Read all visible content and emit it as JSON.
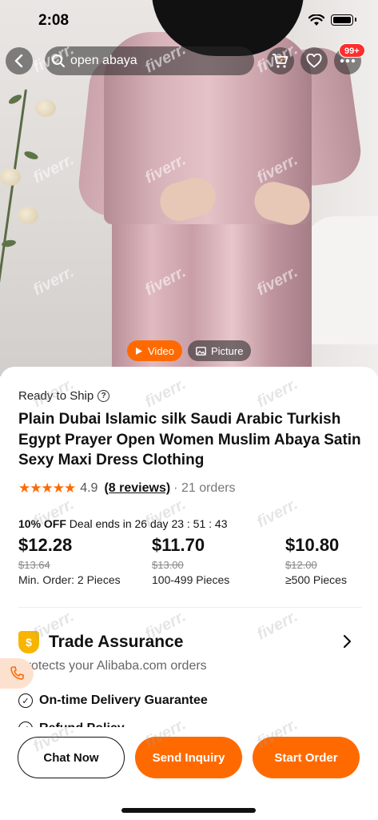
{
  "status_bar": {
    "time": "2:08"
  },
  "search": {
    "query": "open abaya"
  },
  "cart_badge": "99+",
  "media_tabs": [
    {
      "label": "Video"
    },
    {
      "label": "Picture"
    }
  ],
  "product": {
    "shipping_status": "Ready to Ship",
    "title": "Plain Dubai Islamic silk Saudi Arabic Turkish Egypt Prayer Open Women Muslim Abaya Satin Sexy Maxi Dress Clothing",
    "rating": "4.9",
    "reviews": "(8 reviews)",
    "orders": "· 21 orders"
  },
  "deal": {
    "discount": "10% OFF",
    "text": "Deal ends in 26 day 23 : 51 : 43"
  },
  "prices": [
    {
      "price": "$12.28",
      "original": "$13.64",
      "quantity": "Min. Order: 2 Pieces"
    },
    {
      "price": "$11.70",
      "original": "$13.00",
      "quantity": "100-499 Pieces"
    },
    {
      "price": "$10.80",
      "original": "$12.00",
      "quantity": "≥500 Pieces"
    }
  ],
  "trade_assurance": {
    "title": "Trade Assurance",
    "subtitle": "Protects your Alibaba.com orders",
    "features": [
      "On-time Delivery Guarantee",
      "Refund Policy"
    ]
  },
  "actions": {
    "chat": "Chat Now",
    "inquiry": "Send Inquiry",
    "order": "Start Order"
  },
  "watermark": "fiverr.",
  "colors": {
    "accent": "#ff6a00",
    "badge": "#ff2d2d",
    "gold": "#f7b500"
  }
}
